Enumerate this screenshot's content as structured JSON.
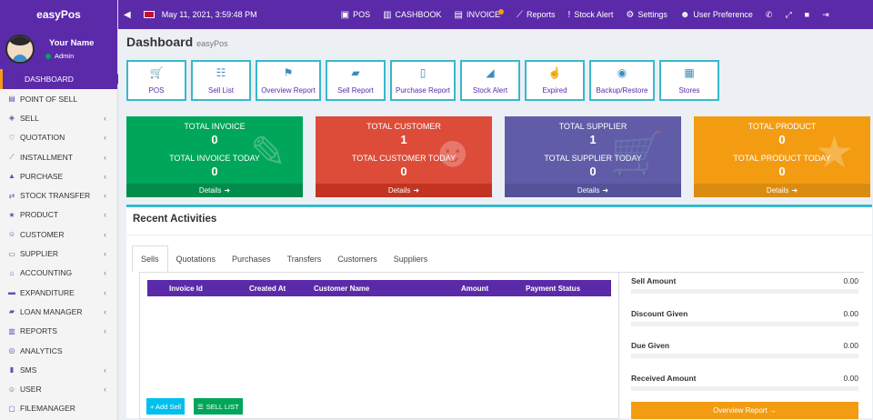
{
  "app": {
    "name": "easyPos"
  },
  "user": {
    "name": "Your Name",
    "role": "Admin"
  },
  "sidebar": {
    "items": [
      {
        "label": "DASHBOARD",
        "icon": "dashboard-icon",
        "caret": false
      },
      {
        "label": "POINT OF SELL",
        "icon": "pos-icon",
        "caret": false
      },
      {
        "label": "SELL",
        "icon": "tag-icon",
        "caret": true
      },
      {
        "label": "QUOTATION",
        "icon": "heart-icon",
        "caret": true
      },
      {
        "label": "INSTALLMENT",
        "icon": "chart-icon",
        "caret": true
      },
      {
        "label": "PURCHASE",
        "icon": "bag-icon",
        "caret": true
      },
      {
        "label": "STOCK TRANSFER",
        "icon": "transfer-icon",
        "caret": true
      },
      {
        "label": "PRODUCT",
        "icon": "star-icon",
        "caret": true
      },
      {
        "label": "CUSTOMER",
        "icon": "user-icon",
        "caret": true
      },
      {
        "label": "SUPPLIER",
        "icon": "truck-icon",
        "caret": true
      },
      {
        "label": "ACCOUNTING",
        "icon": "bank-icon",
        "caret": true
      },
      {
        "label": "EXPANDITURE",
        "icon": "minus-icon",
        "caret": true
      },
      {
        "label": "LOAN MANAGER",
        "icon": "money-icon",
        "caret": true
      },
      {
        "label": "REPORTS",
        "icon": "report-icon",
        "caret": true
      },
      {
        "label": "ANALYTICS",
        "icon": "analytics-icon",
        "caret": false
      },
      {
        "label": "SMS",
        "icon": "sms-icon",
        "caret": true
      },
      {
        "label": "USER",
        "icon": "user-icon",
        "caret": true
      },
      {
        "label": "FILEMANAGER",
        "icon": "folder-icon",
        "caret": false
      }
    ]
  },
  "topbar": {
    "datetime": "May 11, 2021, 3:59:48 PM",
    "pos": "POS",
    "cashbook": "CASHBOOK",
    "invoice": "INVOICE",
    "reports": "Reports",
    "stock_alert": "Stock Alert",
    "settings": "Settings",
    "user_pref": "User Preference"
  },
  "page": {
    "title": "Dashboard",
    "subtitle": "easyPos"
  },
  "shortcuts": [
    {
      "label": "POS",
      "icon": "cart-icon"
    },
    {
      "label": "Sell List",
      "icon": "list-icon"
    },
    {
      "label": "Overview Report",
      "icon": "flag-icon"
    },
    {
      "label": "Sell Report",
      "icon": "money-icon"
    },
    {
      "label": "Purchase Report",
      "icon": "clipboard-icon"
    },
    {
      "label": "Stock Alert",
      "icon": "bullhorn-icon"
    },
    {
      "label": "Expired",
      "icon": "hand-icon"
    },
    {
      "label": "Backup/Restore",
      "icon": "database-icon"
    },
    {
      "label": "Stores",
      "icon": "store-icon"
    }
  ],
  "stats": [
    {
      "label": "TOTAL INVOICE",
      "value": "0",
      "label2": "TOTAL INVOICE TODAY",
      "value2": "0",
      "details": "Details",
      "color": "#00a65a",
      "icon": "pencil-icon"
    },
    {
      "label": "TOTAL CUSTOMER",
      "value": "1",
      "label2": "TOTAL CUSTOMER TODAY",
      "value2": "0",
      "details": "Details",
      "color": "#dd4b39",
      "icon": "users-icon"
    },
    {
      "label": "TOTAL SUPPLIER",
      "value": "1",
      "label2": "TOTAL SUPPLIER TODAY",
      "value2": "0",
      "details": "Details",
      "color": "#605ca8",
      "icon": "cart-icon"
    },
    {
      "label": "TOTAL PRODUCT",
      "value": "0",
      "label2": "TOTAL PRODUCT TODAY",
      "value2": "0",
      "details": "Details",
      "color": "#f39c12",
      "icon": "star-icon"
    }
  ],
  "activities": {
    "title": "Recent Activities",
    "tabs": [
      "Sells",
      "Quotations",
      "Purchases",
      "Transfers",
      "Customers",
      "Suppliers"
    ],
    "columns": [
      "Invoice Id",
      "Created At",
      "Customer Name",
      "Amount",
      "Payment Status"
    ],
    "add_sell": "+ Add Sell",
    "sell_list": "SELL LIST",
    "summary": [
      {
        "label": "Sell Amount",
        "value": "0.00"
      },
      {
        "label": "Discount Given",
        "value": "0.00"
      },
      {
        "label": "Due Given",
        "value": "0.00"
      },
      {
        "label": "Received Amount",
        "value": "0.00"
      }
    ],
    "overview_btn": "Overview Report →"
  }
}
